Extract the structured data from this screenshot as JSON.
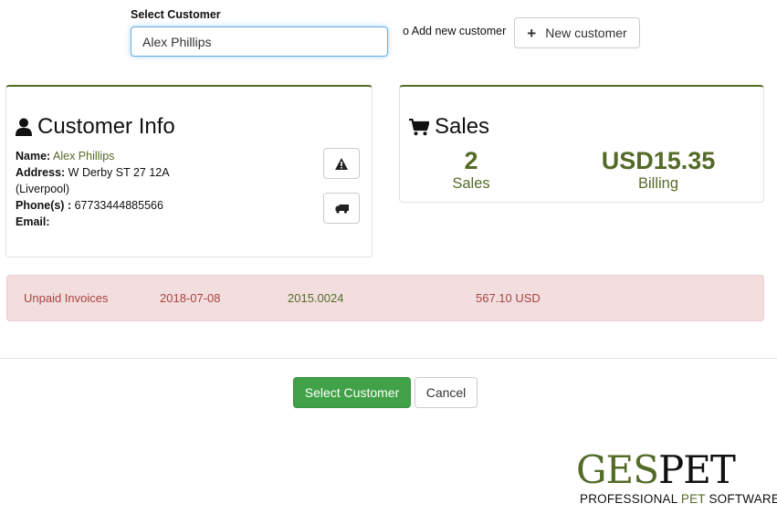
{
  "select": {
    "label": "Select Customer",
    "value": "Alex Phillips",
    "add_new_text": "o Add new customer",
    "new_customer_label": "New customer"
  },
  "customer_info": {
    "title": "Customer Info",
    "name_label": "Name:",
    "name": "Alex Phillips",
    "address_label": "Address:",
    "address_line1": "W Derby ST 27 12A",
    "address_line2": "(Liverpool)",
    "phone_label": "Phone(s) :",
    "phone": "67733444885566",
    "email_label": "Email:",
    "email": "",
    "icons": [
      "user-icon",
      "warning-icon",
      "truck-icon"
    ]
  },
  "sales": {
    "title": "Sales",
    "count": "2",
    "count_label": "Sales",
    "billing": "USD15.35",
    "billing_label": "Billing",
    "icon": "cart-icon"
  },
  "unpaid": {
    "label": "Unpaid Invoices",
    "date": "2018-07-08",
    "number": "2015.0024",
    "amount": "567.10 USD"
  },
  "actions": {
    "select_label": "Select Customer",
    "cancel_label": "Cancel"
  },
  "logo": {
    "word1": "GES",
    "word2": "PET",
    "tag1": "PROFESSIONAL ",
    "tag2": "PET",
    "tag3": " SOFTWARE"
  },
  "colors": {
    "brand_green": "#546b28",
    "primary_button": "#41a148",
    "alert_bg": "#f2dede",
    "alert_text": "#a94442",
    "focus_blue": "#66afe9"
  }
}
